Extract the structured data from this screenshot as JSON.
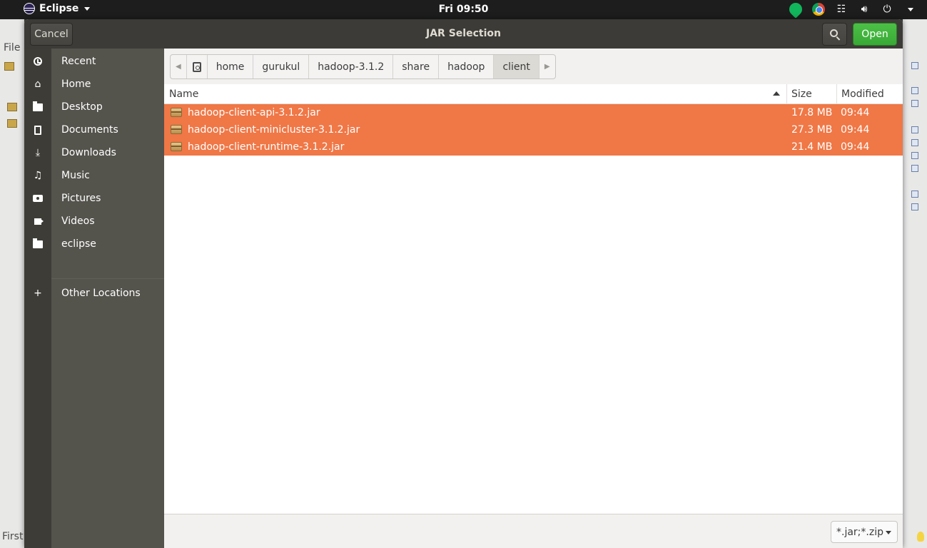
{
  "topbar": {
    "app_name": "Eclipse",
    "clock": "Fri 09:50",
    "tray_icons": [
      "status-green-icon",
      "chrome-icon",
      "network-icon",
      "volume-icon",
      "power-icon"
    ]
  },
  "background_app": {
    "menu_file": "File",
    "status_text": "First"
  },
  "dialog": {
    "title": "JAR Selection",
    "cancel_label": "Cancel",
    "open_label": "Open"
  },
  "sidebar": {
    "places": [
      {
        "label": "Recent",
        "icon": "clock-icon"
      },
      {
        "label": "Home",
        "icon": "home-icon"
      },
      {
        "label": "Desktop",
        "icon": "folder-icon"
      },
      {
        "label": "Documents",
        "icon": "document-icon"
      },
      {
        "label": "Downloads",
        "icon": "download-icon"
      },
      {
        "label": "Music",
        "icon": "music-icon"
      },
      {
        "label": "Pictures",
        "icon": "camera-icon"
      },
      {
        "label": "Videos",
        "icon": "video-icon"
      },
      {
        "label": "eclipse",
        "icon": "folder-icon"
      }
    ],
    "other_locations": "Other Locations"
  },
  "path": {
    "crumbs": [
      "home",
      "gurukul",
      "hadoop-3.1.2",
      "share",
      "hadoop",
      "client"
    ],
    "active": "client"
  },
  "columns": {
    "name": "Name",
    "size": "Size",
    "modified": "Modified"
  },
  "files": [
    {
      "name": "hadoop-client-api-3.1.2.jar",
      "size": "17.8 MB",
      "modified": "09:44"
    },
    {
      "name": "hadoop-client-minicluster-3.1.2.jar",
      "size": "27.3 MB",
      "modified": "09:44"
    },
    {
      "name": "hadoop-client-runtime-3.1.2.jar",
      "size": "21.4 MB",
      "modified": "09:44"
    }
  ],
  "filter": {
    "value": "*.jar;*.zip"
  },
  "colors": {
    "selection": "#f07746",
    "open_button": "#3aa936",
    "sidebar_bg": "#54534c",
    "header_bg": "#3c3b37"
  }
}
